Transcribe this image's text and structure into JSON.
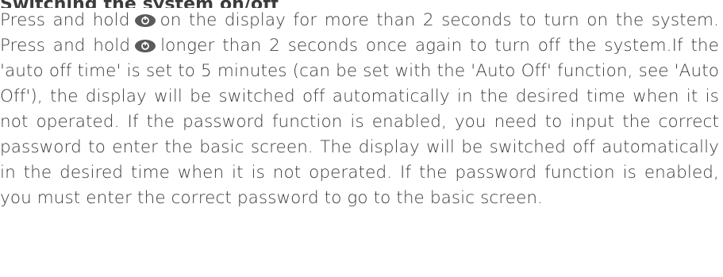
{
  "heading_fragment": "Switching the system on/off",
  "paragraph": {
    "seg1": "Press and hold",
    "seg2": "on the display for more than 2 seconds to turn on the system. Press and hold",
    "seg3": "longer than 2 seconds once again to turn off the system.If the 'auto off time' is set to 5 minutes (can be set with the 'Auto Off' function, see 'Auto Off'), the display will be switched off automatically in the desired time when it is not operated. If the password function is enabled, you need to input the correct password to enter the basic screen. The display will be switched off automatically in the desired time when it is not operated. If the password function is enabled, you must enter the correct password to go to the basic screen."
  },
  "icons": {
    "power_button_color": "#5a5a5a",
    "power_symbol_color": "#ffffff"
  }
}
